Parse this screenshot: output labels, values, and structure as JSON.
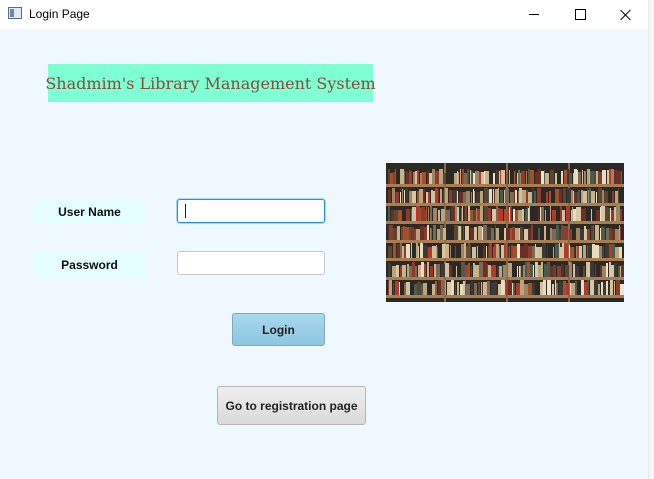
{
  "window": {
    "title": "Login Page"
  },
  "banner": {
    "title": "Shadmim's Library Management System"
  },
  "form": {
    "username_label": "User Name",
    "username_value": "",
    "password_label": "Password",
    "password_value": ""
  },
  "buttons": {
    "login_label": "Login",
    "register_label": "Go to registration page"
  },
  "colors": {
    "banner_bg": "#7fffd4",
    "banner_text": "#8b4a3c",
    "content_bg": "#f0f8ff",
    "label_bg": "#e4fdfd",
    "login_button": "#a8d8ee",
    "focus_border": "#1f95d8"
  },
  "icons": {
    "app": "window-app-icon",
    "minimize": "minimize-icon",
    "maximize": "maximize-icon",
    "close": "close-icon"
  }
}
